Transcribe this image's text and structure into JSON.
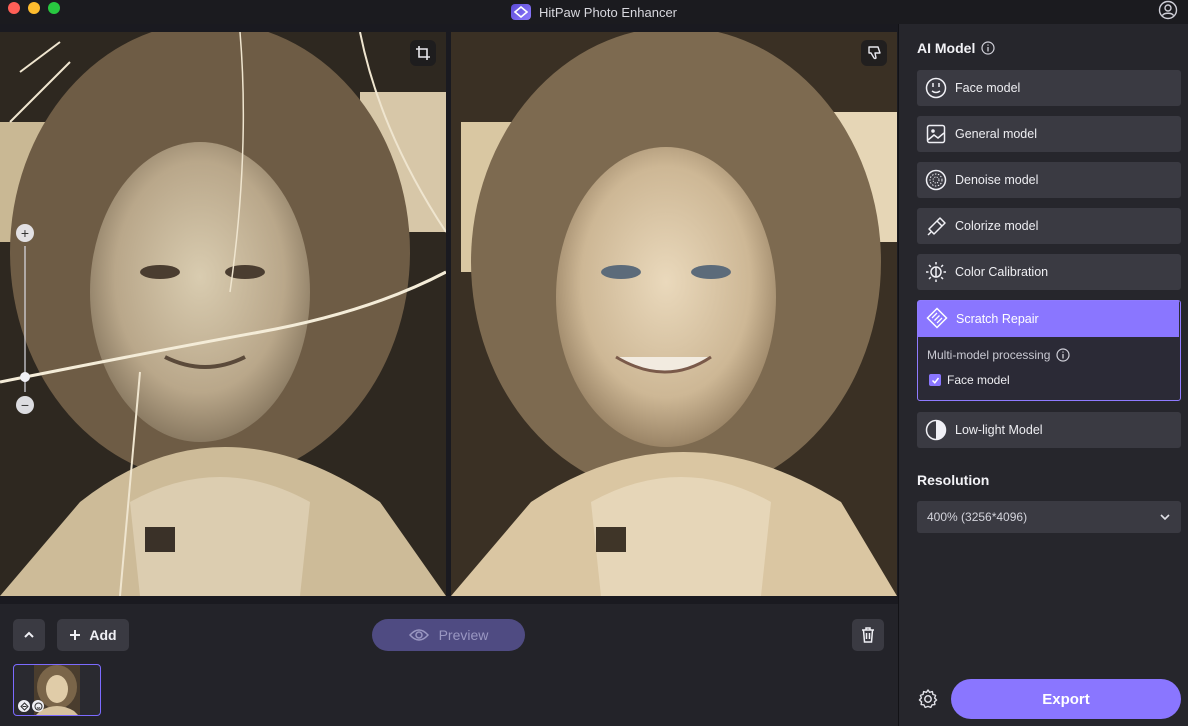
{
  "window": {
    "title": "HitPaw Photo Enhancer"
  },
  "preview_area": {
    "zoom_level": 0.1
  },
  "toolbar": {
    "add_label": "Add",
    "preview_label": "Preview"
  },
  "sidebar": {
    "ai_model_title": "AI Model",
    "models": [
      {
        "label": "Face model",
        "icon": "face-icon"
      },
      {
        "label": "General model",
        "icon": "image-icon"
      },
      {
        "label": "Denoise model",
        "icon": "denoise-icon"
      },
      {
        "label": "Colorize model",
        "icon": "colorize-icon"
      },
      {
        "label": "Color Calibration",
        "icon": "calibration-icon"
      },
      {
        "label": "Scratch Repair",
        "icon": "scratch-repair-icon",
        "selected": true
      },
      {
        "label": "Low-light Model",
        "icon": "low-light-icon"
      }
    ],
    "scratch_repair": {
      "multi_model_label": "Multi-model processing",
      "face_model_option": "Face model",
      "face_model_checked": true
    },
    "resolution_title": "Resolution",
    "resolution_value": "400% (3256*4096)",
    "export_label": "Export"
  },
  "colors": {
    "accent": "#8a76ff",
    "preview_button": "#4f4b82",
    "panel": "#26262c",
    "button": "#3a3a42"
  }
}
